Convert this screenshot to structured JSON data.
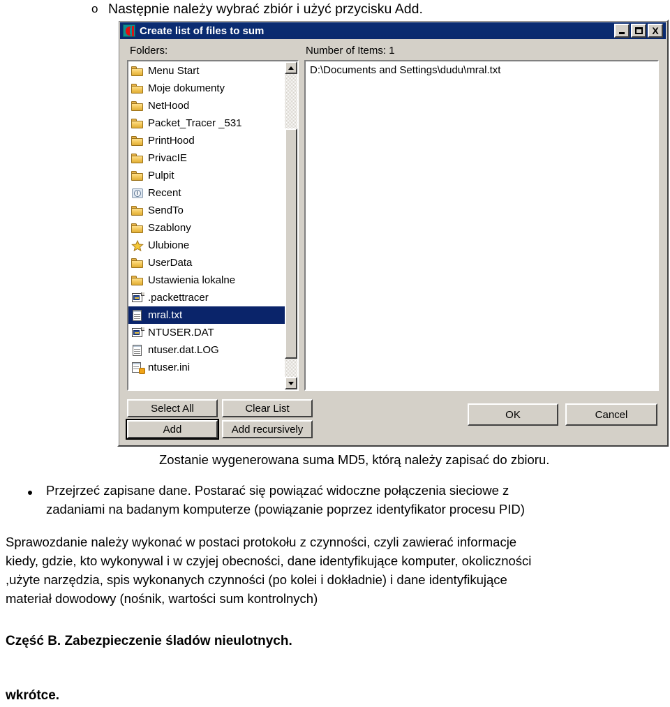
{
  "document": {
    "intro_bullet": "o",
    "intro_text": "Następnie należy wybrać zbiór i użyć przycisku Add.",
    "after_dialog_text": "Zostanie wygenerowana suma MD5, którą należy zapisać do zbioru.",
    "bullet2_lines": [
      "Przejrzeć zapisane dane. Postarać się powiązać widoczne połączenia sieciowe z",
      "zadaniami na badanym komputerze (powiązanie poprzez identyfikator procesu PID)"
    ],
    "paragraph_lines": [
      "Sprawozdanie należy wykonać w postaci protokołu z czynności, czyli zawierać informacje",
      "kiedy, gdzie, kto wykonywal i w czyjej obecności, dane identyfikujące komputer, okoliczności",
      ",użyte narzędzia, spis wykonanych czynności (po kolei i dokładnie) i dane identyfikujące",
      "materiał dowodowy (nośnik, wartości sum kontrolnych)"
    ],
    "section_heading": "Część B. Zabezpieczenie śladów nieulotnych.",
    "footer_text": "wkrótce."
  },
  "dialog": {
    "title": "Create list of files to sum",
    "title_icon": "app-icon",
    "window_buttons": {
      "minimize": "minimize-icon",
      "maximize": "maximize-icon",
      "close": "X"
    },
    "labels": {
      "folders": "Folders:",
      "number_of_items": "Number of Items: 1"
    },
    "folder_list": [
      {
        "name": "Menu Start",
        "icon": "folder-icon",
        "selected": false
      },
      {
        "name": "Moje dokumenty",
        "icon": "folder-icon",
        "selected": false
      },
      {
        "name": "NetHood",
        "icon": "folder-icon",
        "selected": false
      },
      {
        "name": "Packet_Tracer _531",
        "icon": "folder-icon",
        "selected": false
      },
      {
        "name": "PrintHood",
        "icon": "folder-icon",
        "selected": false
      },
      {
        "name": "PrivacIE",
        "icon": "folder-icon",
        "selected": false
      },
      {
        "name": "Pulpit",
        "icon": "folder-icon",
        "selected": false
      },
      {
        "name": "Recent",
        "icon": "clock-icon",
        "selected": false
      },
      {
        "name": "SendTo",
        "icon": "folder-icon",
        "selected": false
      },
      {
        "name": "Szablony",
        "icon": "folder-icon",
        "selected": false
      },
      {
        "name": "Ulubione",
        "icon": "star-icon",
        "selected": false
      },
      {
        "name": "UserData",
        "icon": "folder-icon",
        "selected": false
      },
      {
        "name": "Ustawienia lokalne",
        "icon": "folder-icon",
        "selected": false
      },
      {
        "name": ".packettracer",
        "icon": "registry-icon",
        "selected": false
      },
      {
        "name": "mral.txt",
        "icon": "document-icon",
        "selected": true
      },
      {
        "name": "NTUSER.DAT",
        "icon": "registry-icon",
        "selected": false
      },
      {
        "name": "ntuser.dat.LOG",
        "icon": "document-icon",
        "selected": false
      },
      {
        "name": "ntuser.ini",
        "icon": "ini-icon",
        "selected": false
      }
    ],
    "items_list": [
      "D:\\Documents and Settings\\dudu\\mral.txt"
    ],
    "buttons": {
      "select_all": "Select All",
      "clear_list": "Clear List",
      "add": "Add",
      "add_recursively": "Add recursively",
      "ok": "OK",
      "cancel": "Cancel"
    },
    "colors": {
      "titlebar": "#0b2d73",
      "face": "#d4d0c8",
      "selection": "#0a246a",
      "listbox_bg": "#ffffff"
    },
    "scrollbar": {
      "up_arrow": "scroll-up-icon",
      "down_arrow": "scroll-down-icon"
    }
  }
}
